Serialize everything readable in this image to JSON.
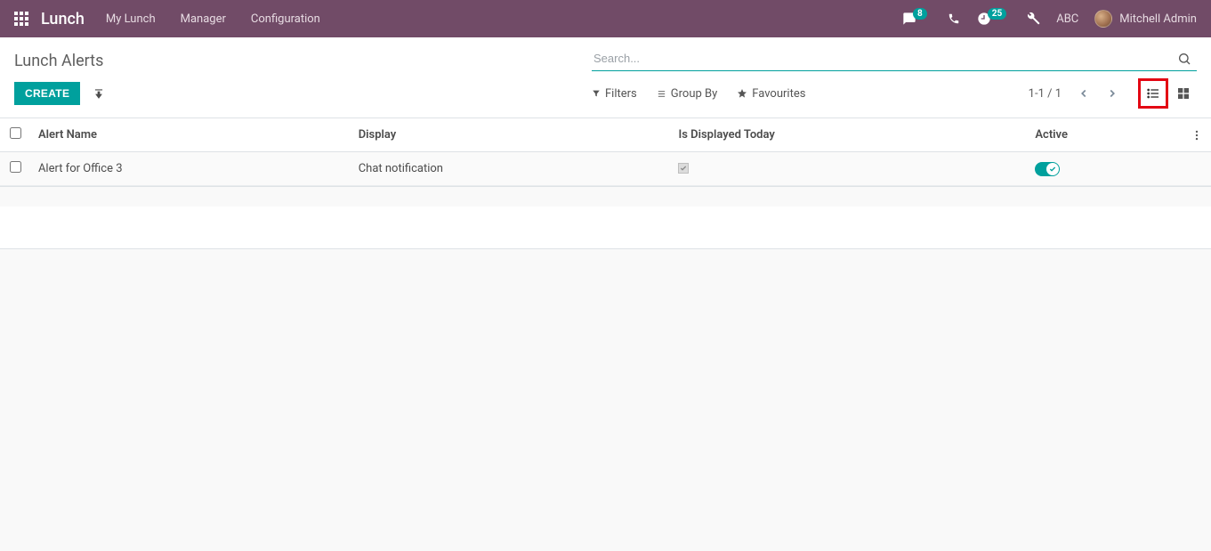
{
  "navbar": {
    "brand": "Lunch",
    "menu": [
      "My Lunch",
      "Manager",
      "Configuration"
    ],
    "messages_count": "8",
    "activities_count": "25",
    "company": "ABC",
    "user_name": "Mitchell Admin"
  },
  "control_panel": {
    "title": "Lunch Alerts",
    "search_placeholder": "Search...",
    "create_label": "CREATE",
    "filters_label": "Filters",
    "group_by_label": "Group By",
    "favourites_label": "Favourites",
    "pager": "1-1 / 1"
  },
  "table": {
    "columns": {
      "alert_name": "Alert Name",
      "display": "Display",
      "is_displayed_today": "Is Displayed Today",
      "active": "Active"
    },
    "rows": [
      {
        "alert_name": "Alert for Office 3",
        "display": "Chat notification",
        "is_displayed_today": true,
        "active": true
      }
    ]
  }
}
